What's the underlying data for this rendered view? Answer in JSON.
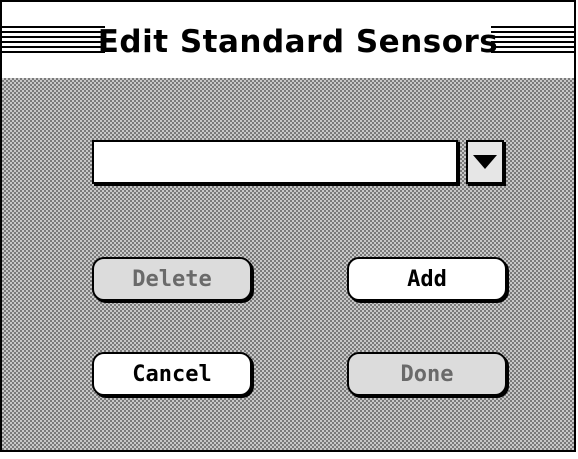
{
  "window": {
    "title": "Edit Standard Sensors"
  },
  "sensor_select": {
    "value": "",
    "placeholder": ""
  },
  "buttons": {
    "delete_label": "Delete",
    "add_label": "Add",
    "cancel_label": "Cancel",
    "done_label": "Done"
  },
  "states": {
    "delete_enabled": false,
    "done_enabled": false
  },
  "icons": {
    "dropdown": "triangle-down-icon"
  },
  "colors": {
    "text": "#000000",
    "background_pattern": "#c8c8c8",
    "disabled_text": "#6a6a6a"
  }
}
